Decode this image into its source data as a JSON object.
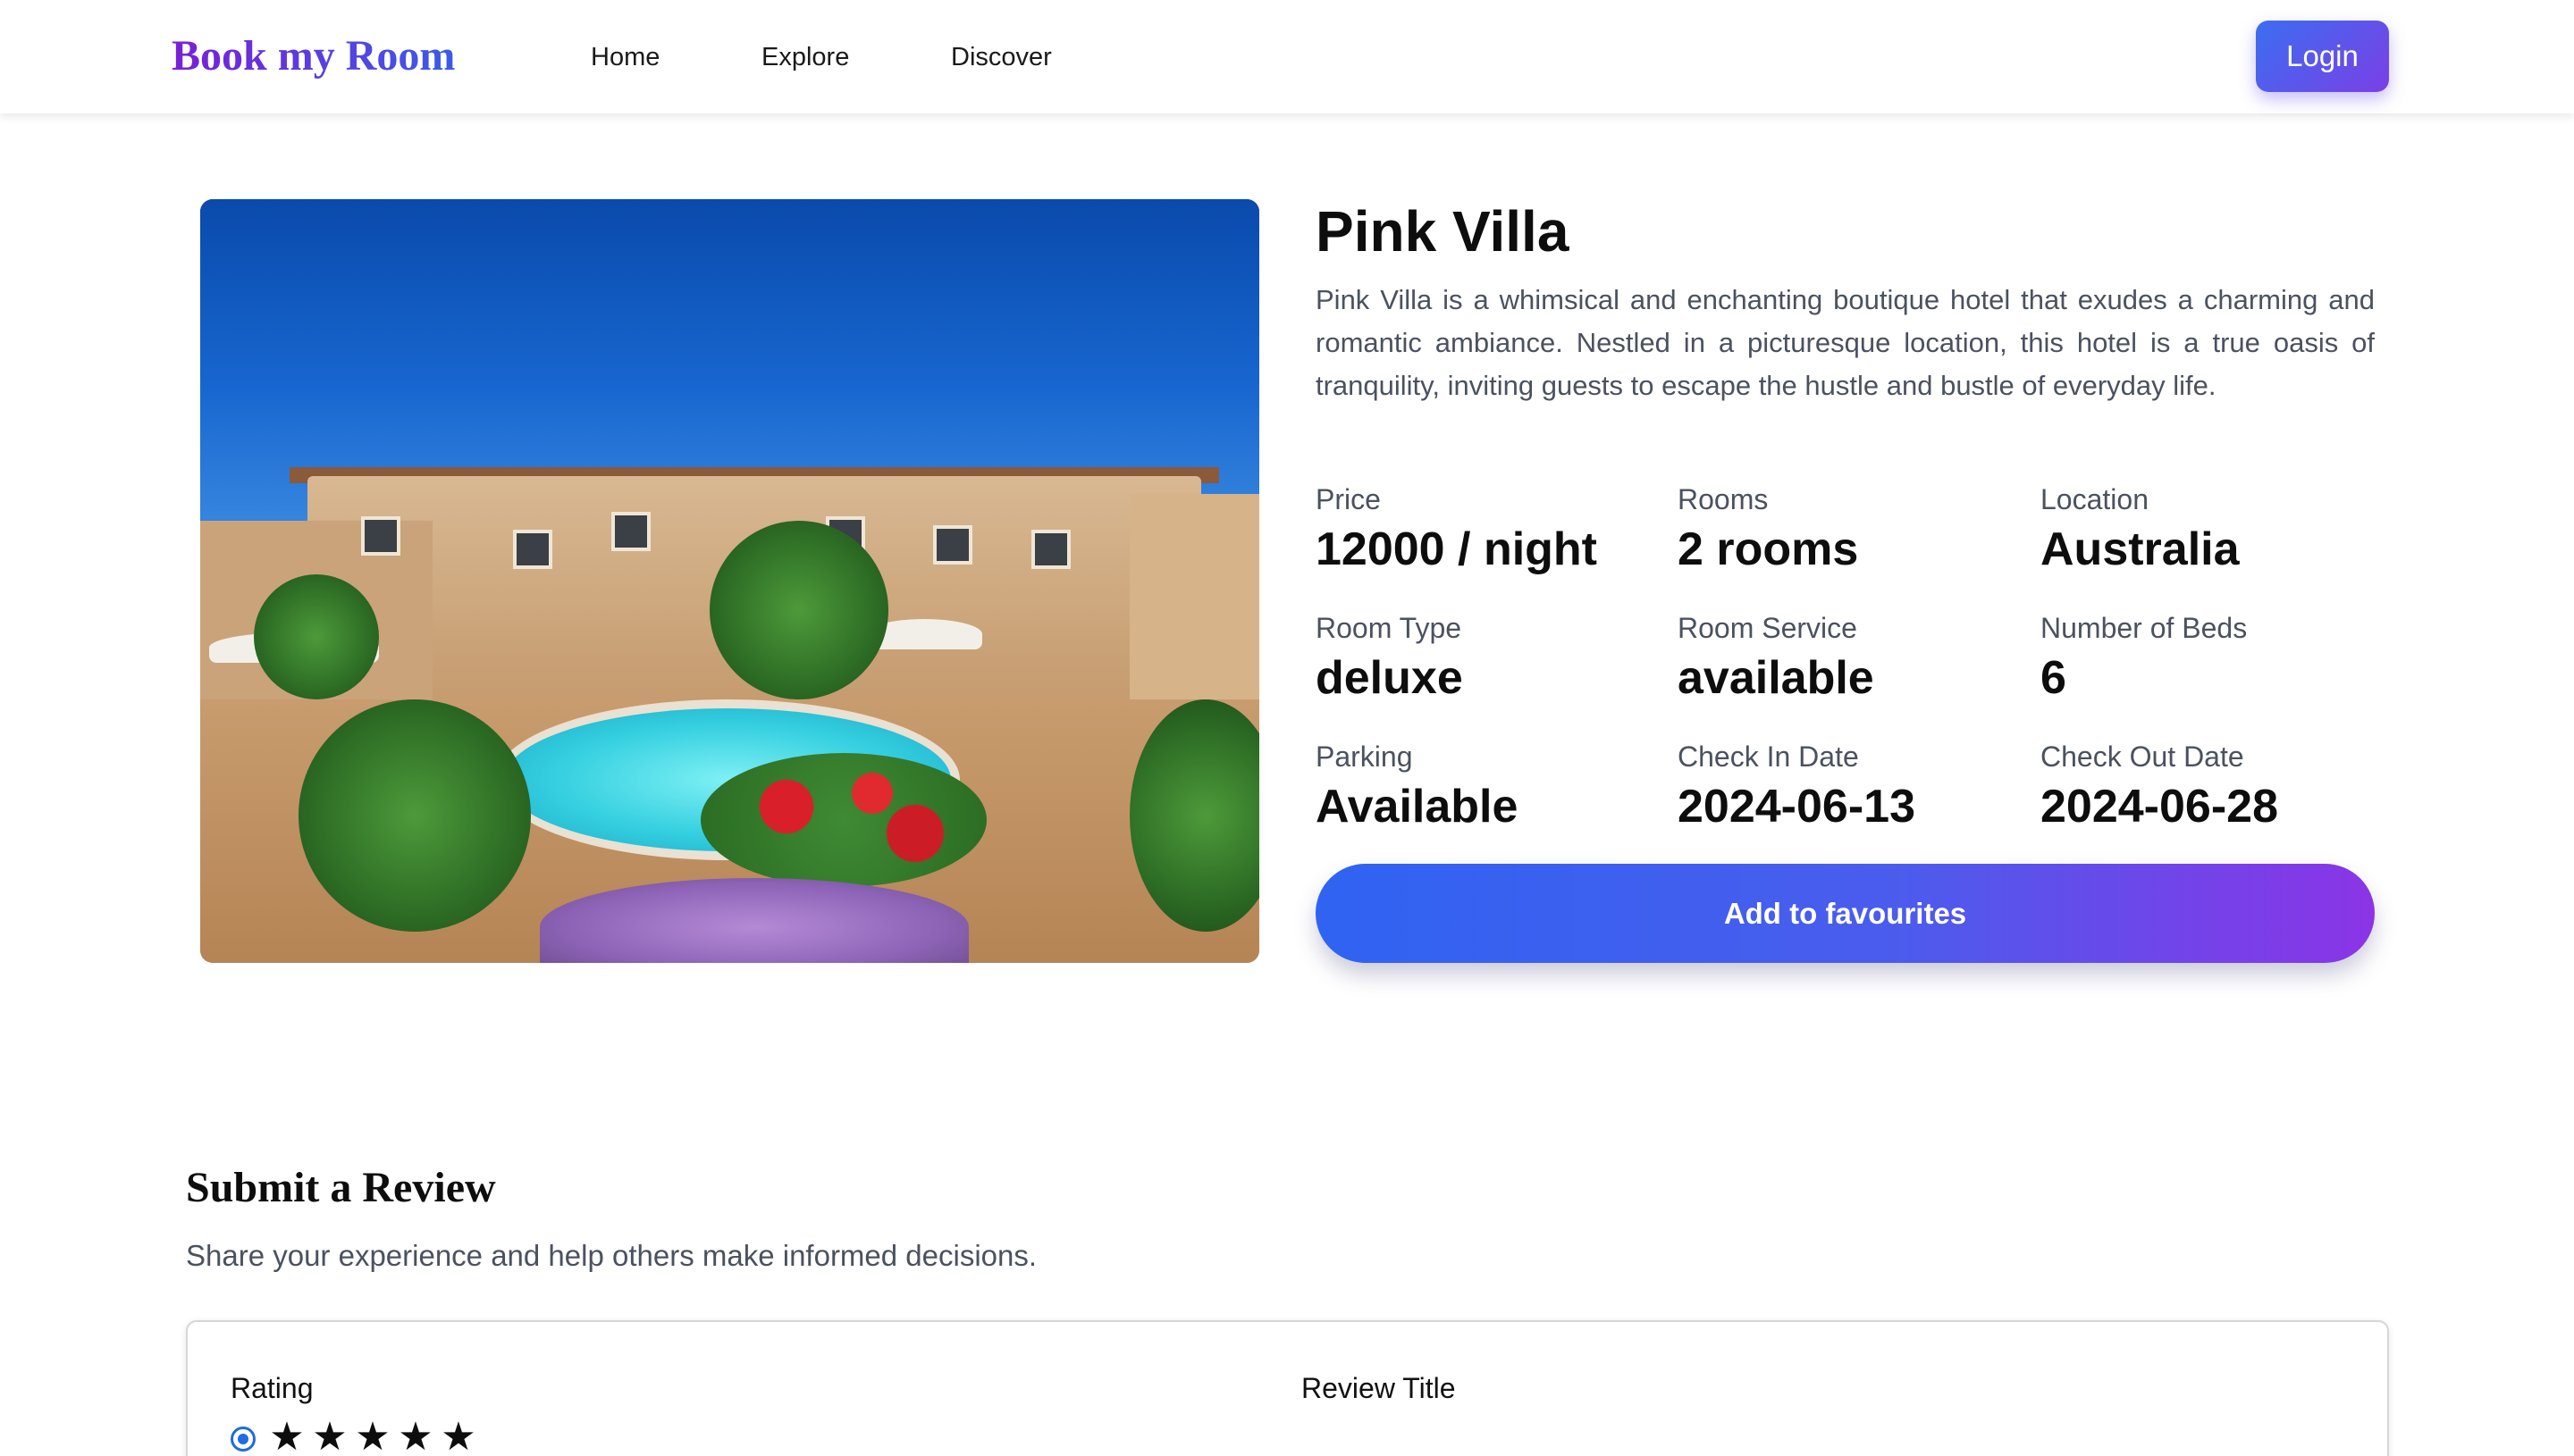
{
  "navbar": {
    "brand": "Book my Room",
    "links": [
      "Home",
      "Explore",
      "Discover"
    ],
    "login_label": "Login"
  },
  "hotel": {
    "name": "Pink Villa",
    "description": "Pink Villa is a whimsical and enchanting boutique hotel that exudes a charming and romantic ambiance. Nestled in a picturesque location, this hotel is a true oasis of tranquility, inviting guests to escape the hustle and bustle of everyday life.",
    "details": [
      {
        "label": "Price",
        "value": "12000 / night"
      },
      {
        "label": "Rooms",
        "value": "2 rooms"
      },
      {
        "label": "Location",
        "value": "Australia"
      },
      {
        "label": "Room Type",
        "value": "deluxe"
      },
      {
        "label": "Room Service",
        "value": "available"
      },
      {
        "label": "Number of Beds",
        "value": "6"
      },
      {
        "label": "Parking",
        "value": "Available"
      },
      {
        "label": "Check In Date",
        "value": "2024-06-13"
      },
      {
        "label": "Check Out Date",
        "value": "2024-06-28"
      }
    ],
    "favourite_label": "Add to favourites"
  },
  "review": {
    "heading": "Submit a Review",
    "subheading": "Share your experience and help others make informed decisions.",
    "rating_label": "Rating",
    "title_label": "Review Title",
    "stars": [
      "★",
      "★",
      "★",
      "★",
      "★"
    ]
  },
  "colors": {
    "brand_gradient_start": "#7a1fd6",
    "brand_gradient_end": "#3b5be8",
    "button_gradient_start": "#2f63f2",
    "button_gradient_end": "#8b34e6",
    "muted_text": "#4a5260"
  }
}
